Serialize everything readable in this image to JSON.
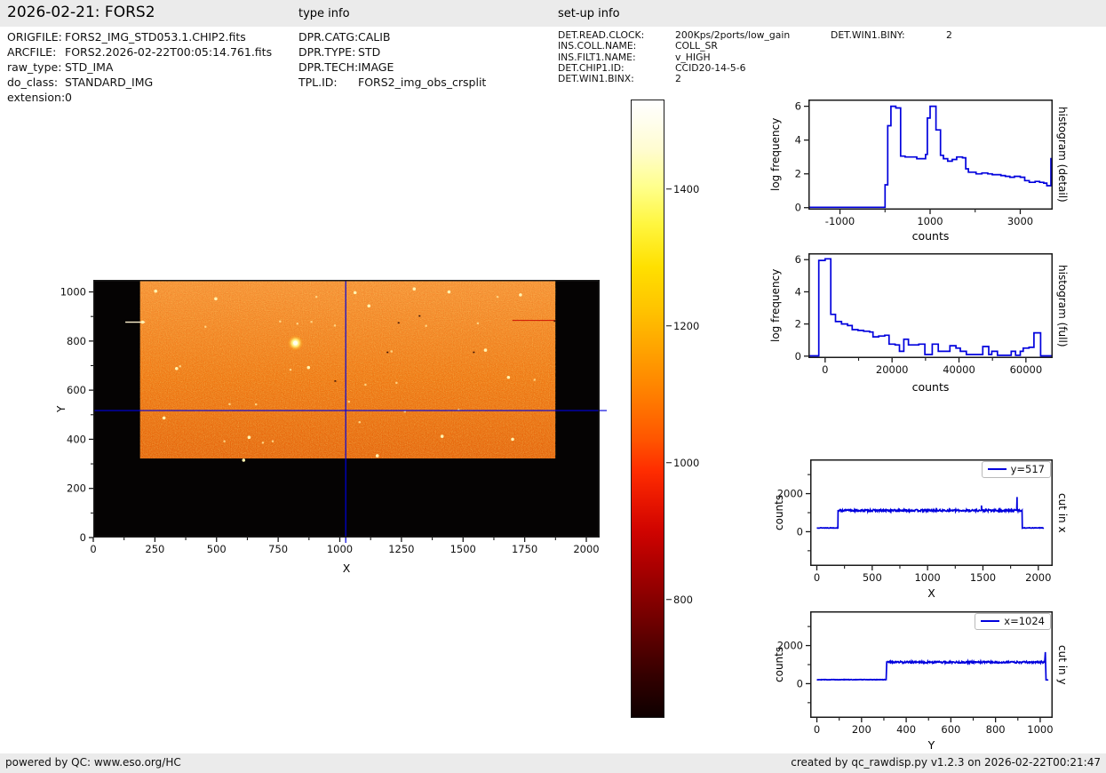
{
  "header": {
    "title": "2026-02-21: FORS2",
    "type_info_title": "type info",
    "setup_info_title": "set-up info"
  },
  "file_info": {
    "rows": [
      {
        "label": "ORIGFILE:",
        "value": "FORS2_IMG_STD053.1.CHIP2.fits"
      },
      {
        "label": "ARCFILE:",
        "value": "FORS2.2026-02-22T00:05:14.761.fits"
      },
      {
        "label": "raw_type:",
        "value": "STD_IMA"
      },
      {
        "label": "do_class:",
        "value": "STANDARD_IMG"
      },
      {
        "label": "extension:",
        "value": "0"
      }
    ]
  },
  "type_info": {
    "rows": [
      {
        "label": "DPR.CATG:",
        "value": "CALIB"
      },
      {
        "label": "DPR.TYPE:",
        "value": "STD"
      },
      {
        "label": "DPR.TECH:",
        "value": "IMAGE"
      },
      {
        "label": "TPL.ID:",
        "value": "FORS2_img_obs_crsplit"
      }
    ]
  },
  "setup_info": {
    "rows": [
      {
        "label": "DET.READ.CLOCK:",
        "value": "200Kps/2ports/low_gain"
      },
      {
        "label": "INS.COLL.NAME:",
        "value": "COLL_SR"
      },
      {
        "label": "INS.FILT1.NAME:",
        "value": "v_HIGH"
      },
      {
        "label": "DET.CHIP1.ID:",
        "value": "CCID20-14-5-6"
      },
      {
        "label": "DET.WIN1.BINX:",
        "value": "2"
      }
    ],
    "right_rows": [
      {
        "label": "DET.WIN1.BINY:",
        "value": "2"
      }
    ]
  },
  "colorbar": {
    "vmin": 627,
    "vmax": 1531,
    "ticks": [
      {
        "value": 1400,
        "label": "1400"
      },
      {
        "value": 1200,
        "label": "1200"
      },
      {
        "value": 1000,
        "label": "1000"
      },
      {
        "value": 800,
        "label": "800"
      }
    ]
  },
  "chart_data": {
    "panels": [
      {
        "id": "main",
        "type": "image",
        "color": "#0000dd",
        "xlabel": "X",
        "ylabel": "Y",
        "xlim": [
          0,
          2054
        ],
        "ylim": [
          0,
          1049
        ],
        "xticks": [
          0,
          250,
          500,
          750,
          1000,
          1250,
          1500,
          1750,
          2000
        ],
        "yticks": [
          0,
          200,
          400,
          600,
          800,
          1000
        ],
        "xminor_step": 125,
        "yminor_step": 100,
        "image": {
          "region": [
            190,
            1874,
            322,
            1049
          ],
          "base": [
            "#fd9238",
            "#f4740f",
            "#e85d06"
          ],
          "crosshair": [
            1024,
            517
          ],
          "streaks": [
            [
              130,
              877,
              210,
              877,
              "#fff3cf",
              1.4
            ],
            [
              1700,
              884,
              1874,
              884,
              "#cc1100",
              1
            ]
          ],
          "stars": [
            [
              820,
              792,
              2
            ],
            [
              200,
              877,
              1
            ],
            [
              253,
              1003,
              1
            ],
            [
              497,
              972,
              1
            ],
            [
              1062,
              997,
              1
            ],
            [
              1302,
              1012,
              1
            ],
            [
              1443,
              1000,
              1
            ],
            [
              1118,
              943,
              1
            ],
            [
              338,
              688,
              1
            ],
            [
              287,
              487,
              1
            ],
            [
              610,
              315,
              1
            ],
            [
              873,
              692,
              1
            ],
            [
              1415,
              412,
              1
            ],
            [
              1701,
              400,
              1
            ],
            [
              1152,
              333,
              1
            ],
            [
              1591,
              763,
              1
            ],
            [
              1684,
              652,
              1
            ],
            [
              1733,
              988,
              1
            ],
            [
              632,
              408,
              1
            ],
            [
              352,
              697,
              0
            ],
            [
              728,
              392,
              0
            ],
            [
              688,
              386,
              0
            ],
            [
              553,
              543,
              0
            ],
            [
              800,
              683,
              0
            ],
            [
              885,
              878,
              0
            ],
            [
              828,
              871,
              0
            ],
            [
              1230,
              630,
              0
            ],
            [
              1104,
              622,
              0
            ],
            [
              1037,
              553,
              0
            ],
            [
              1264,
              513,
              0
            ],
            [
              1350,
              862,
              0
            ],
            [
              1560,
              872,
              0
            ],
            [
              980,
              863,
              0
            ],
            [
              1210,
              758,
              0
            ],
            [
              1080,
              470,
              0
            ],
            [
              455,
              858,
              0
            ],
            [
              660,
              542,
              0
            ],
            [
              1790,
              642,
              0
            ],
            [
              532,
              392,
              0
            ],
            [
              905,
              980,
              0
            ],
            [
              1640,
              980,
              0
            ],
            [
              1482,
              520,
              0
            ],
            [
              758,
              880,
              0
            ]
          ],
          "specks": [
            [
              1190,
              757
            ],
            [
              1235,
              877
            ],
            [
              1540,
              757
            ],
            [
              978,
              640
            ],
            [
              1320,
              905
            ],
            [
              1868,
              884
            ]
          ]
        }
      },
      {
        "id": "hist_detail",
        "type": "step",
        "color": "#0000dd",
        "xlabel": "counts",
        "ylabel": "log frequency",
        "right_label": "histogram (detail)",
        "xlim": [
          -1700,
          3720
        ],
        "ylim": [
          -0.12,
          6.4
        ],
        "xticks": [
          -1000,
          1000,
          3000
        ],
        "xminors": [
          0,
          2000
        ],
        "yticks": [
          0,
          2,
          4,
          6
        ],
        "bins": [
          [
            -1700,
            0,
            0.02
          ],
          [
            0,
            60,
            1.35
          ],
          [
            60,
            130,
            4.85
          ],
          [
            130,
            240,
            6.0
          ],
          [
            240,
            345,
            5.9
          ],
          [
            345,
            445,
            3.05
          ],
          [
            445,
            705,
            3.0
          ],
          [
            705,
            900,
            2.9
          ],
          [
            900,
            940,
            3.15
          ],
          [
            940,
            1000,
            5.3
          ],
          [
            1000,
            1130,
            6.0
          ],
          [
            1130,
            1230,
            4.6
          ],
          [
            1230,
            1295,
            3.1
          ],
          [
            1295,
            1390,
            2.9
          ],
          [
            1390,
            1490,
            2.75
          ],
          [
            1490,
            1590,
            2.85
          ],
          [
            1590,
            1720,
            3.0
          ],
          [
            1720,
            1790,
            2.95
          ],
          [
            1790,
            1850,
            2.3
          ],
          [
            1850,
            2020,
            2.1
          ],
          [
            2020,
            2150,
            2.0
          ],
          [
            2150,
            2280,
            2.05
          ],
          [
            2280,
            2380,
            2.0
          ],
          [
            2380,
            2570,
            1.95
          ],
          [
            2570,
            2670,
            1.9
          ],
          [
            2670,
            2770,
            1.85
          ],
          [
            2770,
            2870,
            1.8
          ],
          [
            2870,
            3000,
            1.85
          ],
          [
            3000,
            3100,
            1.8
          ],
          [
            3100,
            3200,
            1.6
          ],
          [
            3200,
            3330,
            1.5
          ],
          [
            3330,
            3430,
            1.55
          ],
          [
            3430,
            3520,
            1.5
          ],
          [
            3520,
            3590,
            1.45
          ],
          [
            3590,
            3680,
            1.3
          ],
          [
            3680,
            3720,
            2.9
          ]
        ]
      },
      {
        "id": "hist_full",
        "type": "step",
        "color": "#0000dd",
        "xlabel": "counts",
        "ylabel": "log frequency",
        "right_label": "histogram (full)",
        "xlim": [
          -5000,
          68000
        ],
        "ylim": [
          -0.12,
          6.4
        ],
        "xticks": [
          0,
          20000,
          40000,
          60000
        ],
        "xminors": [
          10000,
          30000,
          50000
        ],
        "yticks": [
          0,
          2,
          4,
          6
        ],
        "bins": [
          [
            -5000,
            -1900,
            0.02
          ],
          [
            -1900,
            0,
            5.95
          ],
          [
            0,
            1700,
            6.05
          ],
          [
            1700,
            3100,
            2.6
          ],
          [
            3100,
            4900,
            2.15
          ],
          [
            4900,
            6700,
            2.0
          ],
          [
            6700,
            8100,
            1.9
          ],
          [
            8100,
            9800,
            1.65
          ],
          [
            9800,
            11500,
            1.6
          ],
          [
            11500,
            13300,
            1.55
          ],
          [
            13300,
            14300,
            1.5
          ],
          [
            14300,
            16000,
            1.2
          ],
          [
            16000,
            17800,
            1.25
          ],
          [
            17800,
            19100,
            1.3
          ],
          [
            19100,
            20900,
            0.75
          ],
          [
            20900,
            22200,
            0.7
          ],
          [
            22200,
            23500,
            0.3
          ],
          [
            23500,
            24900,
            1.05
          ],
          [
            24900,
            28000,
            0.7
          ],
          [
            28000,
            29800,
            0.75
          ],
          [
            29800,
            32000,
            0.1
          ],
          [
            32000,
            33800,
            0.75
          ],
          [
            33800,
            37300,
            0.3
          ],
          [
            37300,
            39100,
            0.65
          ],
          [
            39100,
            40400,
            0.5
          ],
          [
            40400,
            42200,
            0.3
          ],
          [
            42200,
            47100,
            0.1
          ],
          [
            47100,
            48900,
            0.6
          ],
          [
            48900,
            49800,
            0.1
          ],
          [
            49800,
            51500,
            0.3
          ],
          [
            51500,
            55600,
            0.05
          ],
          [
            55600,
            56900,
            0.3
          ],
          [
            56900,
            58300,
            0.05
          ],
          [
            58300,
            59200,
            0.3
          ],
          [
            59200,
            60900,
            0.5
          ],
          [
            60900,
            62400,
            0.55
          ],
          [
            62400,
            64400,
            1.45
          ],
          [
            64400,
            68000,
            0.02
          ]
        ]
      },
      {
        "id": "cut_x",
        "type": "profile",
        "color": "#0000dd",
        "seed": 13,
        "xlabel": "X",
        "ylabel": "counts",
        "right_label": "cut in x",
        "legend": "y=517",
        "xlim": [
          -60,
          2130
        ],
        "ylim": [
          -1800,
          3800
        ],
        "xticks": [
          0,
          500,
          1000,
          1500,
          2000
        ],
        "xminors": [
          250,
          750,
          1250,
          1750
        ],
        "yticks": [
          0,
          2000
        ],
        "yminors": [
          -1000,
          1000,
          3000
        ],
        "profile": [
          [
            0,
            190,
            200,
            14
          ],
          [
            192,
            1853,
            1115,
            52
          ],
          [
            1856,
            2050,
            200,
            14
          ]
        ],
        "spikes": [
          [
            1487,
            1380
          ],
          [
            1808,
            1820
          ]
        ]
      },
      {
        "id": "cut_y",
        "type": "profile",
        "color": "#0000dd",
        "seed": 29,
        "xlabel": "Y",
        "ylabel": "counts",
        "right_label": "cut in y",
        "legend": "x=1024",
        "xlim": [
          -30,
          1056
        ],
        "ylim": [
          -1800,
          3800
        ],
        "xticks": [
          0,
          200,
          400,
          600,
          800,
          1000
        ],
        "xminors": [
          100,
          300,
          500,
          700,
          900
        ],
        "yticks": [
          0,
          2000
        ],
        "yminors": [
          -1000,
          1000,
          3000
        ],
        "profile": [
          [
            0,
            310,
            210,
            13
          ],
          [
            313,
            1020,
            1125,
            48
          ],
          [
            1026,
            1036,
            200,
            8
          ]
        ],
        "spikes": [
          [
            1023,
            1660
          ]
        ]
      }
    ]
  },
  "footer": {
    "left": "powered by QC: www.eso.org/HC",
    "right": "created by qc_rawdisp.py v1.2.3 on 2026-02-22T00:21:47"
  }
}
